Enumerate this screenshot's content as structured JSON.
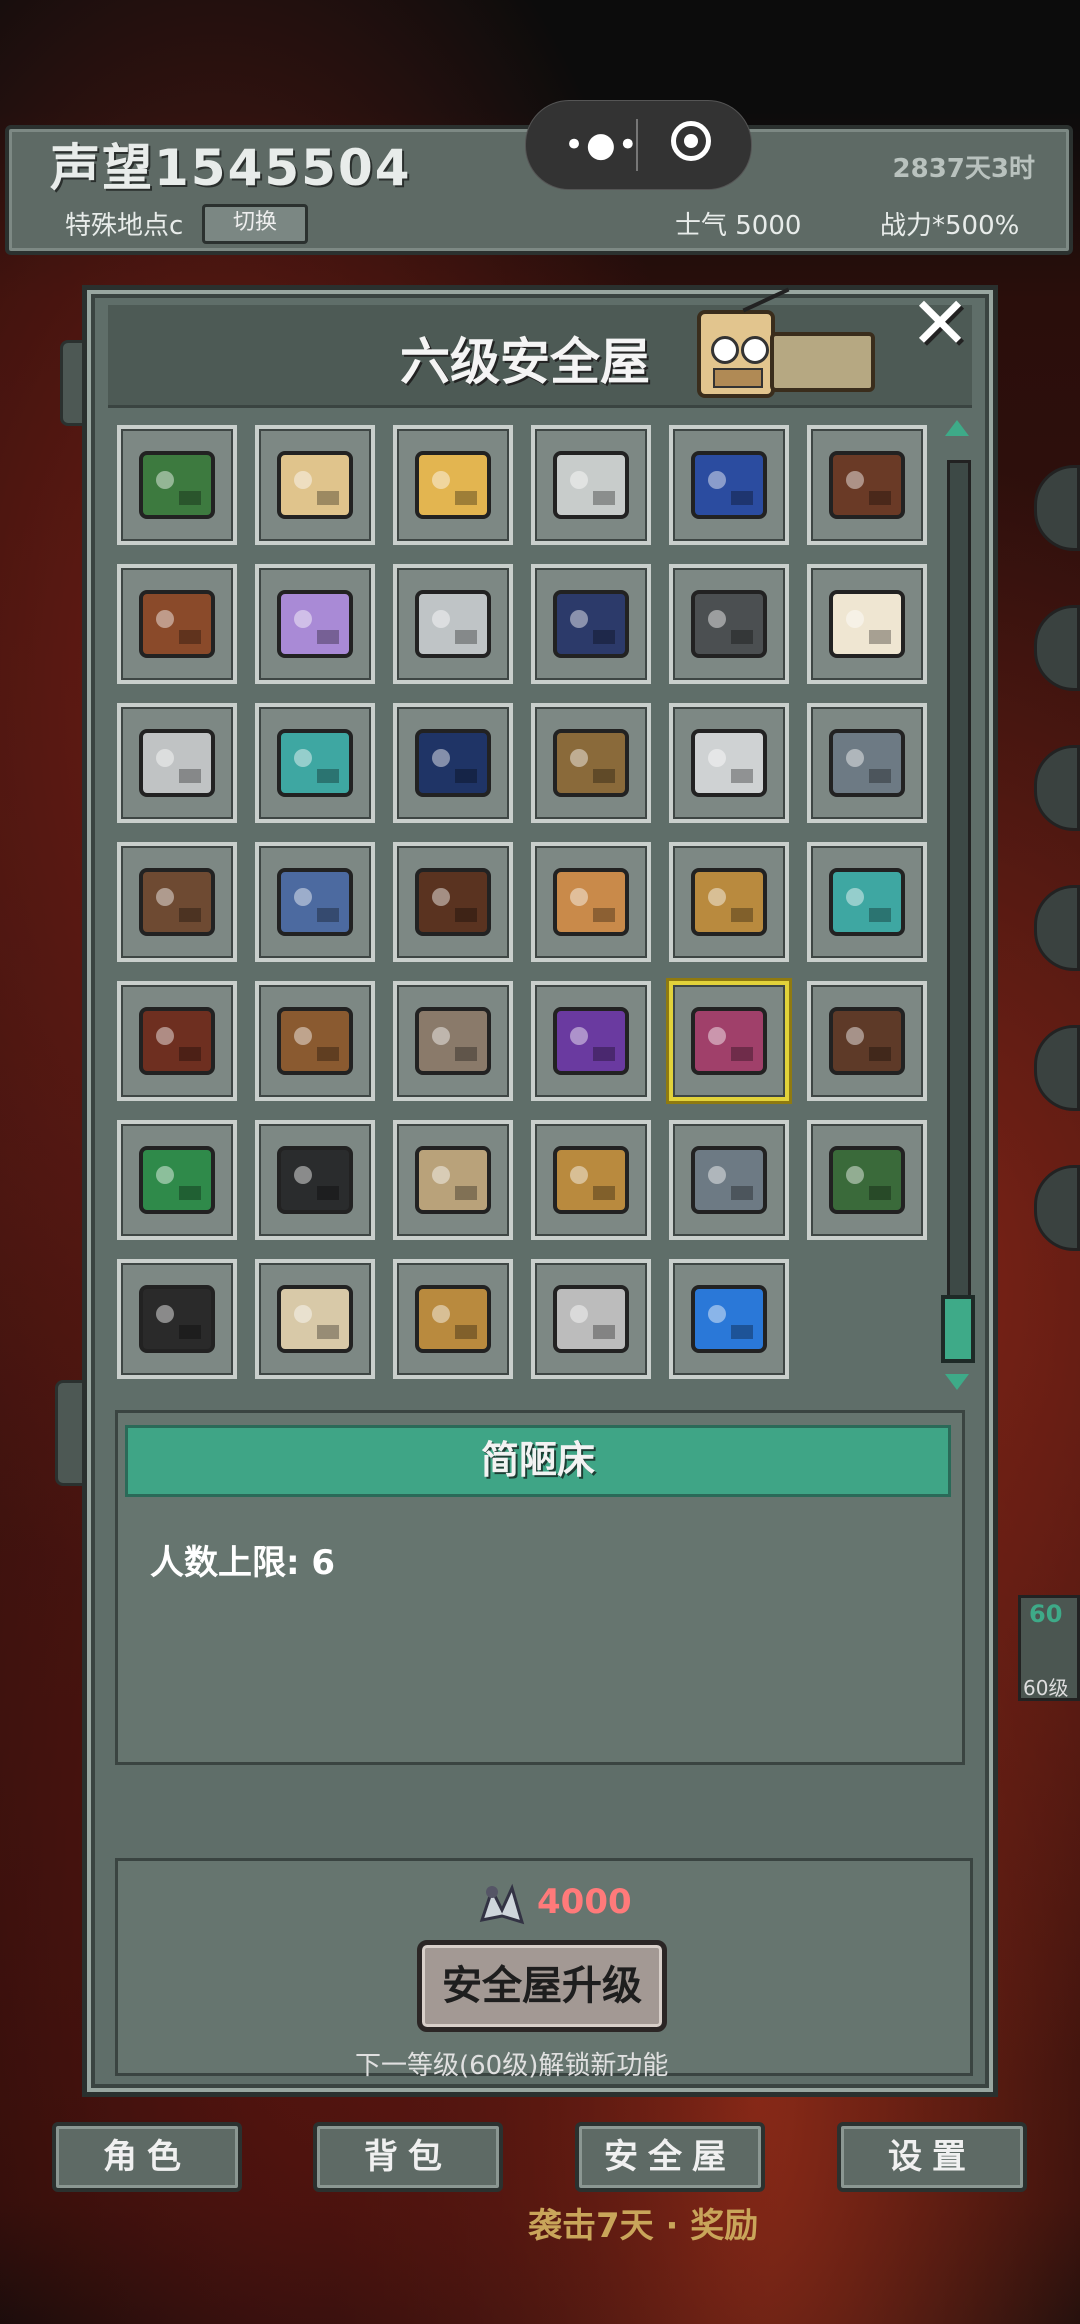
{
  "header": {
    "reputation": "声望1545504",
    "special_location": "特殊地点c",
    "switch_label": "切换",
    "days": "2837天3时",
    "morale": "士气  5000",
    "combat_power": "战力*500%"
  },
  "panel": {
    "title": "六级安全屋",
    "close_label": "✕"
  },
  "furniture_icons": [
    "billiard-table",
    "radio",
    "folding-table",
    "crafting-machine",
    "dartboard-plate",
    "piano",
    "crate-with-items",
    "sofa-cushion",
    "round-table",
    "arcade-console",
    "floor-vent",
    "bed",
    "workbench-machine",
    "teal-desk",
    "statue-figure",
    "shelf",
    "cooking-pot",
    "lab-bench",
    "dining-table",
    "gamepad",
    "drawer-cabinet",
    "l-sofa",
    "planter-bed",
    "teal-desk-2",
    "tv-stand",
    "tool-crate",
    "wardrobe",
    "purple-pet-desk",
    "pink-desk",
    "round-dining-table",
    "potted-plant",
    "dark-cabinet",
    "jeep",
    "planter-bed-2",
    "lab-bench-2",
    "pond",
    "toolbox",
    "armchair-sofa",
    "planter-bed-3",
    "spider-car",
    "teleporter"
  ],
  "selected_index": 28,
  "detail": {
    "name": "简陋床",
    "capacity": "人数上限: 6"
  },
  "upgrade": {
    "cost": "4000",
    "button_label": "安全屋升级",
    "unlock_hint": "下一等级(60级)解锁新功能"
  },
  "nav": {
    "character": "角色",
    "backpack": "背包",
    "safehouse": "安全屋",
    "settings": "设置"
  },
  "raid_text": "袭击7天 · 奖励",
  "side_badge": {
    "top": "60",
    "bottom": "60级"
  },
  "colors": {
    "accent": "#3eaa88",
    "cost": "#ff7a7a",
    "selected": "#e2d23a"
  }
}
